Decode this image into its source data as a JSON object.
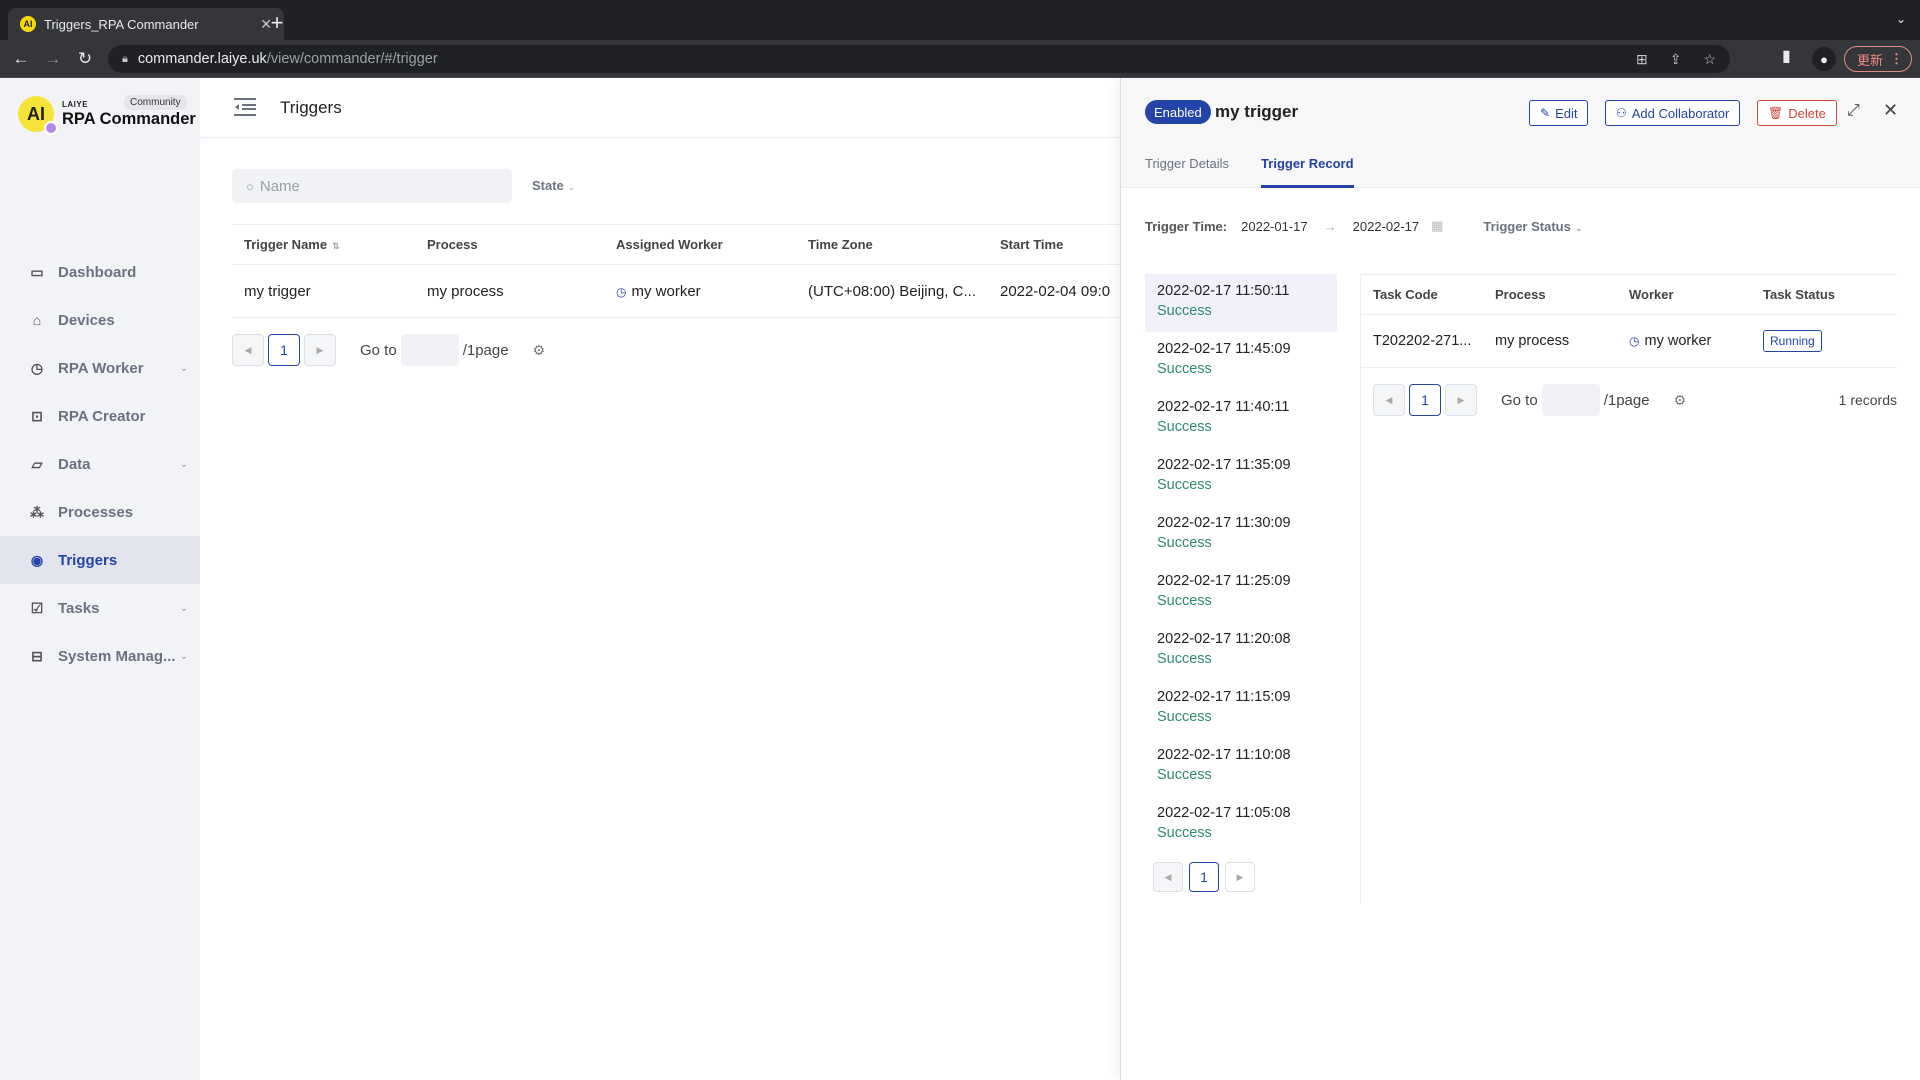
{
  "browser": {
    "tab_title": "Triggers_RPA Commander",
    "url_host": "commander.laiye.uk",
    "url_path": "/view/commander/#/trigger",
    "update_label": "更新"
  },
  "sidebar": {
    "brand": "LAIYE",
    "app_name": "RPA Commander",
    "edition": "Community",
    "items": [
      {
        "label": "Dashboard",
        "icon": "monitor-chart-icon",
        "glyph": "▭",
        "expandable": false
      },
      {
        "label": "Devices",
        "icon": "router-icon",
        "glyph": "⌂",
        "expandable": false
      },
      {
        "label": "RPA Worker",
        "icon": "stopwatch-icon",
        "glyph": "◷",
        "expandable": true
      },
      {
        "label": "RPA Creator",
        "icon": "terminal-icon",
        "glyph": "⊡",
        "expandable": false
      },
      {
        "label": "Data",
        "icon": "folder-icon",
        "glyph": "▱",
        "expandable": true
      },
      {
        "label": "Processes",
        "icon": "nodes-icon",
        "glyph": "⁂",
        "expandable": false
      },
      {
        "label": "Triggers",
        "icon": "broadcast-icon",
        "glyph": "◉",
        "expandable": false,
        "active": true
      },
      {
        "label": "Tasks",
        "icon": "checkbox-icon",
        "glyph": "☑",
        "expandable": true
      },
      {
        "label": "System Manag...",
        "icon": "settings-panel-icon",
        "glyph": "⊟",
        "expandable": true
      }
    ]
  },
  "main": {
    "title": "Triggers",
    "search_placeholder": "Name",
    "state_filter": "State",
    "table": {
      "columns": [
        "Trigger Name",
        "Process",
        "Assigned Worker",
        "Time Zone",
        "Start Time"
      ],
      "rows": [
        {
          "name": "my trigger",
          "process": "my process",
          "worker": "my worker",
          "timezone": "(UTC+08:00) Beijing, C...",
          "start_time": "2022-02-04 09:0"
        }
      ]
    },
    "pagination": {
      "current": "1",
      "goto_label": "Go to",
      "total_label": "/1page"
    }
  },
  "drawer": {
    "status": "Enabled",
    "title": "my trigger",
    "actions": {
      "edit": "Edit",
      "add_collaborator": "Add Collaborator",
      "delete": "Delete"
    },
    "tabs": [
      {
        "label": "Trigger Details",
        "active": false
      },
      {
        "label": "Trigger Record",
        "active": true
      }
    ],
    "filters": {
      "time_label": "Trigger Time:",
      "start_date": "2022-01-17",
      "end_date": "2022-02-17",
      "status_label": "Trigger Status"
    },
    "records": [
      {
        "time": "2022-02-17 11:50:11",
        "status": "Success"
      },
      {
        "time": "2022-02-17 11:45:09",
        "status": "Success"
      },
      {
        "time": "2022-02-17 11:40:11",
        "status": "Success"
      },
      {
        "time": "2022-02-17 11:35:09",
        "status": "Success"
      },
      {
        "time": "2022-02-17 11:30:09",
        "status": "Success"
      },
      {
        "time": "2022-02-17 11:25:09",
        "status": "Success"
      },
      {
        "time": "2022-02-17 11:20:08",
        "status": "Success"
      },
      {
        "time": "2022-02-17 11:15:09",
        "status": "Success"
      },
      {
        "time": "2022-02-17 11:10:08",
        "status": "Success"
      },
      {
        "time": "2022-02-17 11:05:08",
        "status": "Success"
      }
    ],
    "records_page": "1",
    "tasks": {
      "columns": [
        "Task Code",
        "Process",
        "Worker",
        "Task Status"
      ],
      "rows": [
        {
          "code": "T202202-271...",
          "process": "my process",
          "worker": "my worker",
          "status": "Running"
        }
      ],
      "pagination": {
        "current": "1",
        "goto_label": "Go to",
        "total_label": "/1page",
        "count": "1 records"
      }
    }
  },
  "colors": {
    "accent": "#2443a8",
    "success": "#2f8a6f",
    "danger": "#d0453a"
  }
}
